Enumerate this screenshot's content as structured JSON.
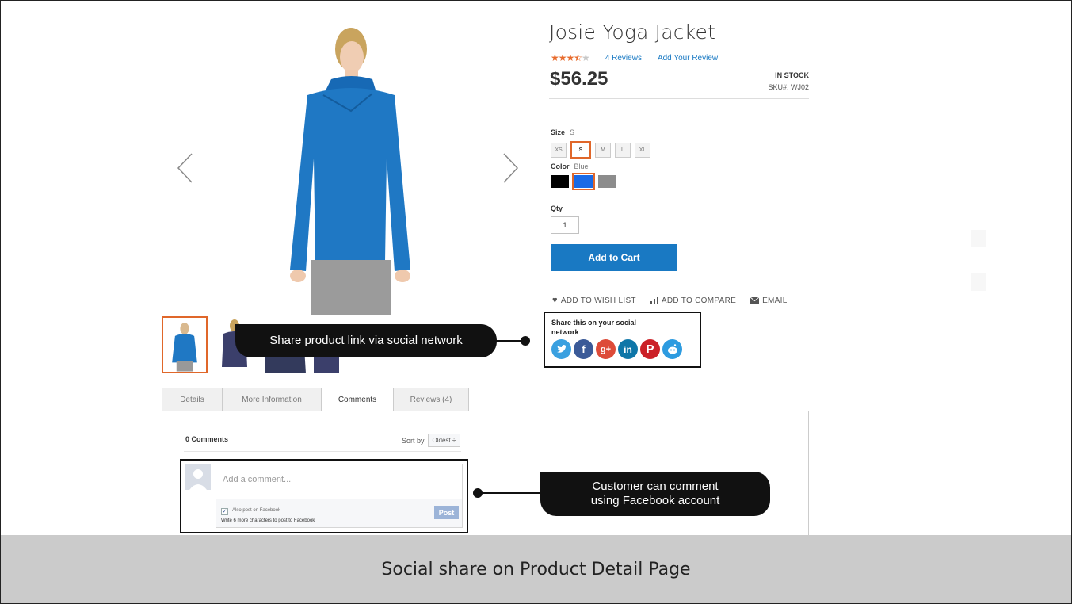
{
  "product": {
    "title": "Josie Yoga Jacket",
    "rating_stars": 3.5,
    "reviews_link": "4 Reviews",
    "add_review": "Add Your Review",
    "price": "$56.25",
    "stock": "IN STOCK",
    "sku_label": "SKU#:",
    "sku_value": "WJ02"
  },
  "options": {
    "size_label": "Size",
    "size_selected": "S",
    "sizes": [
      "XS",
      "S",
      "M",
      "L",
      "XL"
    ],
    "color_label": "Color",
    "color_selected": "Blue",
    "colors": [
      "#000000",
      "#1a6ae6",
      "#8c8c8c"
    ],
    "qty_label": "Qty",
    "qty_value": "1"
  },
  "buttons": {
    "add_to_cart": "Add to Cart"
  },
  "actions": {
    "wishlist": "ADD TO WISH LIST",
    "compare": "ADD TO COMPARE",
    "email": "EMAIL"
  },
  "share": {
    "label": "Share this on your social network",
    "networks": [
      "twitter-icon",
      "facebook-icon",
      "google-plus-icon",
      "linkedin-icon",
      "pinterest-icon",
      "reddit-icon"
    ]
  },
  "callouts": {
    "share": "Share product link via social network",
    "comment_line1": "Customer can comment",
    "comment_line2": "using Facebook account"
  },
  "tabs": [
    "Details",
    "More Information",
    "Comments",
    "Reviews (4)"
  ],
  "active_tab": "Comments",
  "comments": {
    "count": "0 Comments",
    "sort_label": "Sort by",
    "sort_value": "Oldest ÷",
    "placeholder": "Add a comment...",
    "fb_checkbox": "Also post on Facebook",
    "fb_note": "Write 6 more characters to post to Facebook",
    "post": "Post"
  },
  "banner": "Social share on Product Detail Page",
  "colors": {
    "accent": "#1979c3",
    "highlight": "#e0672a",
    "jacket": "#1f78c4"
  }
}
